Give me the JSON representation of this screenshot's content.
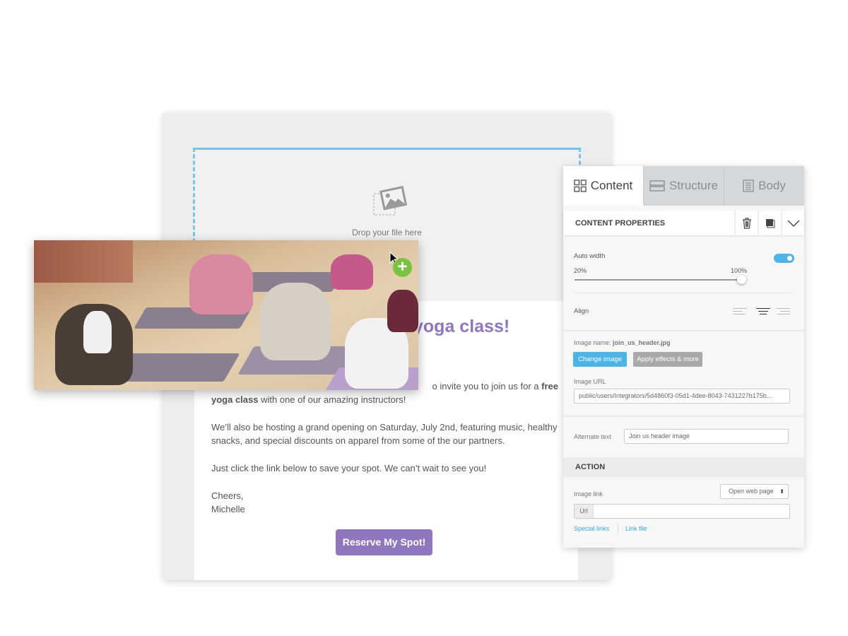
{
  "email": {
    "drop_text": "Drop your file here",
    "heading_visible": "yoga class!",
    "para1_partial": "o invite you to join us for a ",
    "para1_bold_end": "free",
    "para1_bold_start": "yoga class",
    "para1_rest": " with one of our amazing instructors!",
    "para2": "We’ll also be hosting a grand opening on Saturday, July 2nd, featuring music, healthy snacks, and special discounts on apparel from some of the our partners.",
    "para3": "Just click the link below to save your spot. We can’t wait to see you!",
    "signoff": "Cheers,",
    "signature": "Michelle",
    "cta": "Reserve My Spot!",
    "accent": "#8f76bd"
  },
  "panel": {
    "tabs": [
      {
        "label": "Content",
        "icon": "grid-icon"
      },
      {
        "label": "Structure",
        "icon": "rows-icon"
      },
      {
        "label": "Body",
        "icon": "body-icon"
      }
    ],
    "section_title": "CONTENT PROPERTIES",
    "auto_width_label": "Auto width",
    "auto_width_on": true,
    "slider_min": "20%",
    "slider_max": "100%",
    "slider_value": 100,
    "align_label": "Align",
    "align_selected": "center",
    "image_name_label": "Image name: ",
    "image_name": "join_us_header.jpg",
    "change_image": "Change image",
    "apply_effects": "Apply effects & more",
    "image_url_label": "Image URL",
    "image_url": "public/users/Integrators/5d4860f3-05d1-4dee-8043-7431227b175b...",
    "alt_label": "Alternate text",
    "alt_value": "Join us header image",
    "action_title": "ACTION",
    "image_link_label": "Image link",
    "link_type": "Open web page",
    "url_prefix": "Url",
    "url_value": "",
    "special_links": "Special links",
    "link_file": "Link file",
    "accent": "#4db4e8"
  }
}
